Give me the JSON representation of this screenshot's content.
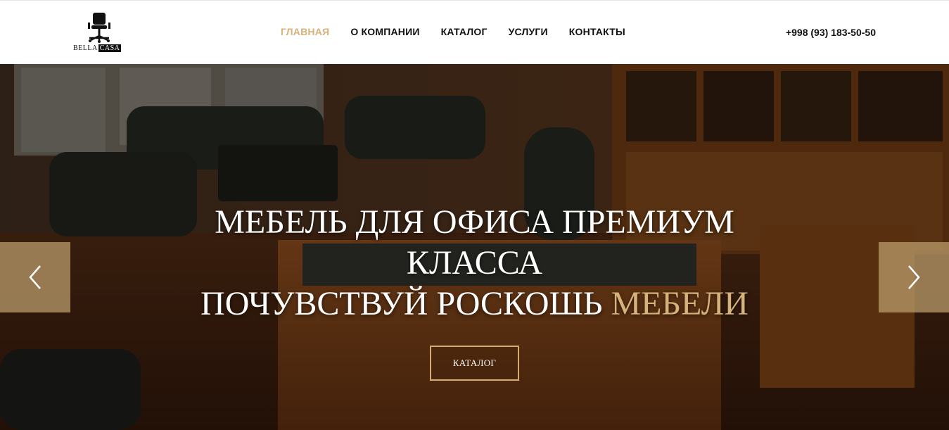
{
  "header": {
    "logo": {
      "text_left": "BELLA",
      "text_right": "CASA",
      "icon": "office-chair-icon"
    },
    "nav": [
      {
        "label": "ГЛАВНАЯ",
        "active": true
      },
      {
        "label": "О КОМПАНИИ",
        "active": false
      },
      {
        "label": "КАТАЛОГ",
        "active": false
      },
      {
        "label": "УСЛУГИ",
        "active": false
      },
      {
        "label": "КОНТАКТЫ",
        "active": false
      }
    ],
    "phone": "+998 (93) 183-50-50"
  },
  "hero": {
    "line1": "МЕБЕЛЬ ДЛЯ ОФИСА ПРЕМИУМ",
    "line2": "КЛАССА",
    "line3_white": "ПОЧУВСТВУЙ РОСКОШЬ",
    "line3_accent": "МЕБЕЛИ",
    "cta_label": "КАТАЛОГ",
    "prev_icon": "chevron-left-icon",
    "next_icon": "chevron-right-icon"
  },
  "colors": {
    "accent": "#d8b07a",
    "arrow_bg": "#bea06e",
    "text_dark": "#111111"
  }
}
